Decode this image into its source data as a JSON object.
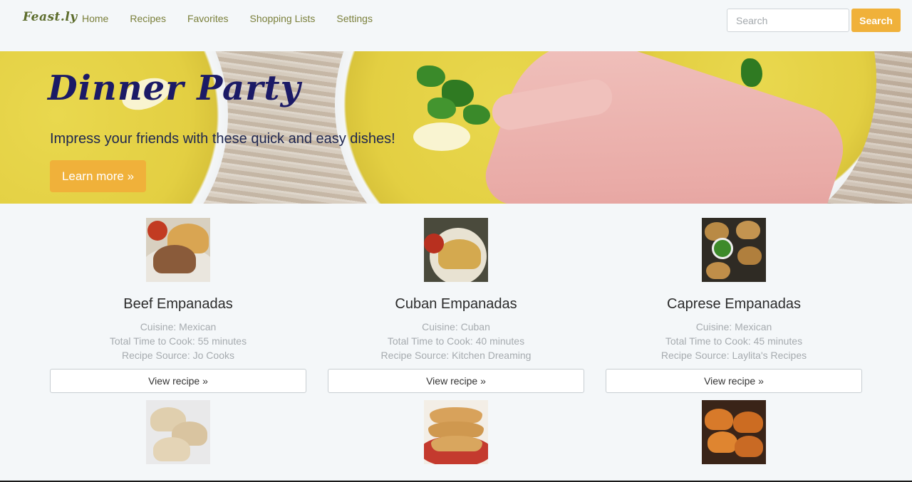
{
  "brand": "Feast.ly",
  "nav": [
    {
      "label": "Home"
    },
    {
      "label": "Recipes"
    },
    {
      "label": "Favorites"
    },
    {
      "label": "Shopping Lists"
    },
    {
      "label": "Settings"
    }
  ],
  "search": {
    "placeholder": "Search",
    "button_label": "Search"
  },
  "hero": {
    "title": "Dinner Party",
    "subtitle": "Impress your friends with these quick and easy dishes!",
    "button_label": "Learn more »"
  },
  "recipes": [
    {
      "name": "Beef Empanadas",
      "cuisine": "Cuisine: Mexican",
      "time": "Total Time to Cook: 55 minutes",
      "source": "Recipe Source: Jo Cooks",
      "button_label": "View recipe »"
    },
    {
      "name": "Cuban Empanadas",
      "cuisine": "Cuisine: Cuban",
      "time": "Total Time to Cook: 40 minutes",
      "source": "Recipe Source: Kitchen Dreaming",
      "button_label": "View recipe »"
    },
    {
      "name": "Caprese Empanadas",
      "cuisine": "Cuisine: Mexican",
      "time": "Total Time to Cook: 45 minutes",
      "source": "Recipe Source: Laylita's Recipes",
      "button_label": "View recipe »"
    }
  ],
  "colors": {
    "accent": "#f0b13a",
    "nav_text": "#7a7f3a",
    "hero_title": "#1b1a66",
    "background": "#f4f7f9"
  }
}
